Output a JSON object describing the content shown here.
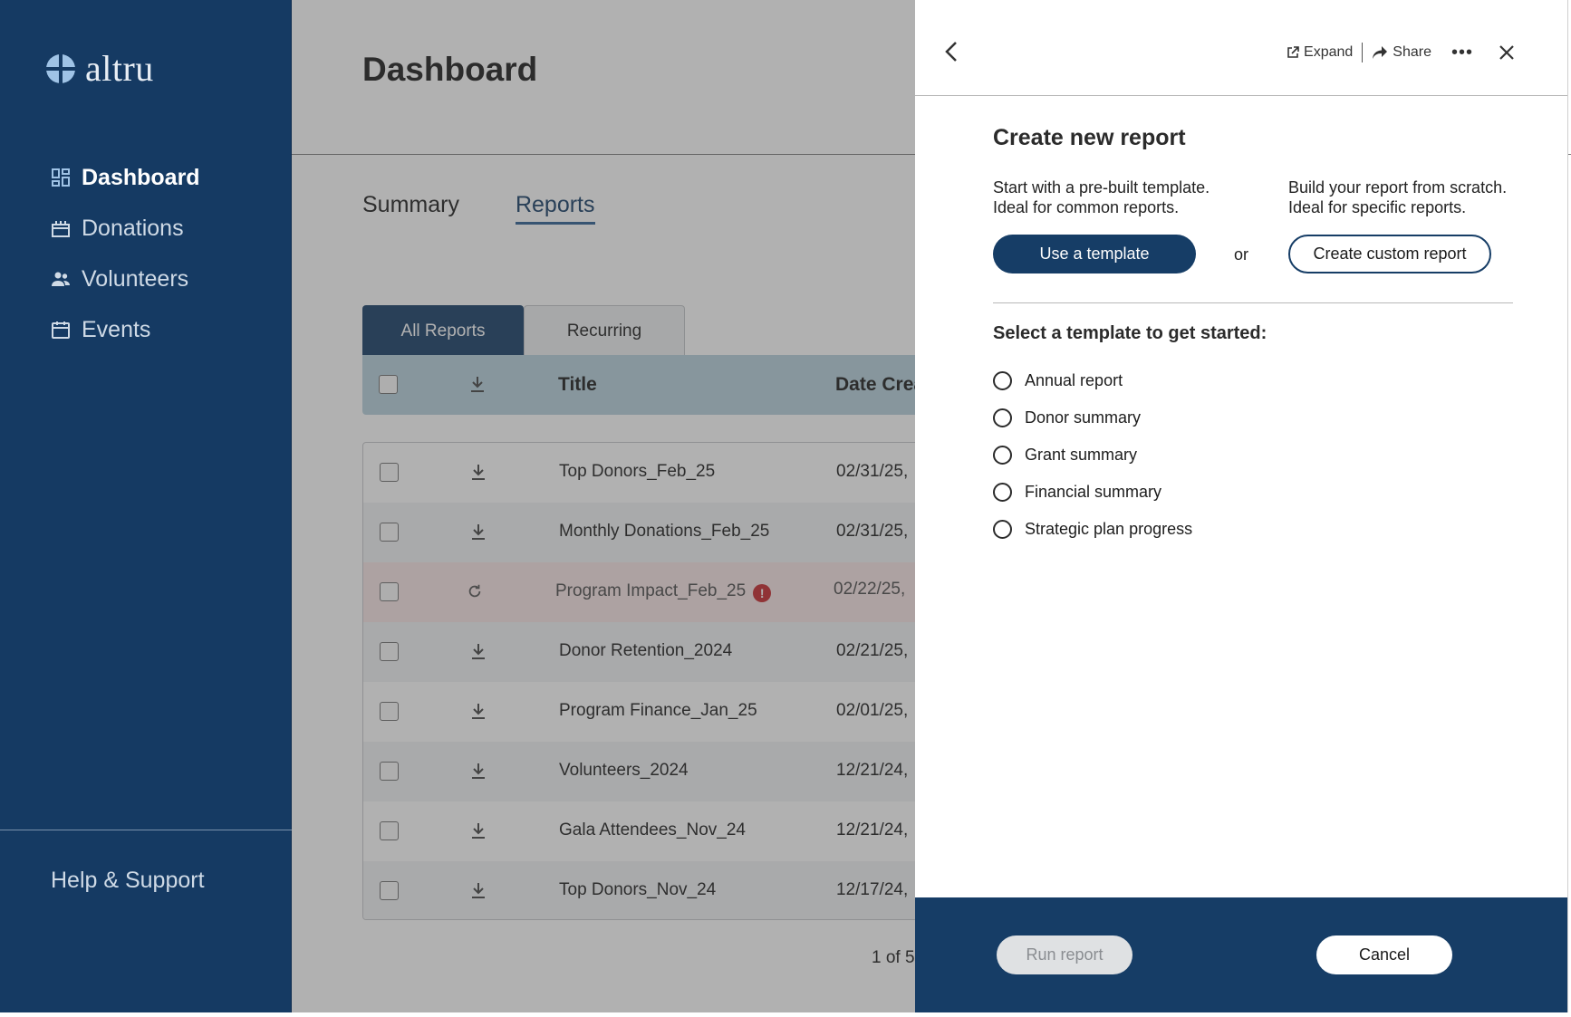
{
  "sidebar": {
    "logo_text": "altru",
    "nav": [
      {
        "label": "Dashboard",
        "icon": "dashboard-icon",
        "active": true
      },
      {
        "label": "Donations",
        "icon": "gift-icon"
      },
      {
        "label": "Volunteers",
        "icon": "people-icon"
      },
      {
        "label": "Events",
        "icon": "calendar-icon"
      }
    ],
    "help_label": "Help & Support"
  },
  "main": {
    "page_title": "Dashboard",
    "tabs": [
      {
        "label": "Summary"
      },
      {
        "label": "Reports",
        "active": true
      }
    ],
    "subtabs": [
      {
        "label": "All Reports",
        "active": true
      },
      {
        "label": "Recurring"
      }
    ],
    "table": {
      "columns": [
        "Title",
        "Date Crea"
      ],
      "rows": [
        {
          "title": "Top Donors_Feb_25",
          "date": "02/31/25,",
          "icon": "download-icon"
        },
        {
          "title": "Monthly Donations_Feb_25",
          "date": "02/31/25,",
          "icon": "download-icon"
        },
        {
          "title": "Program Impact_Feb_25",
          "date": "02/22/25,",
          "icon": "refresh-icon",
          "error": true,
          "error_mark": "!"
        },
        {
          "title": "Donor Retention_2024",
          "date": "02/21/25,",
          "icon": "download-icon"
        },
        {
          "title": "Program Finance_Jan_25",
          "date": "02/01/25,",
          "icon": "download-icon"
        },
        {
          "title": "Volunteers_2024",
          "date": "12/21/24,",
          "icon": "download-icon"
        },
        {
          "title": "Gala Attendees_Nov_24",
          "date": "12/21/24,",
          "icon": "download-icon"
        },
        {
          "title": "Top Donors_Nov_24",
          "date": "12/17/24,",
          "icon": "download-icon"
        }
      ]
    },
    "pager": "1 of 5"
  },
  "panel": {
    "actions": {
      "expand": "Expand",
      "share": "Share"
    },
    "title": "Create new report",
    "template_desc_1": "Start with a pre-built template.",
    "template_desc_2": "Ideal for common reports.",
    "custom_desc_1": "Build your report from scratch.",
    "custom_desc_2": "Ideal for specific reports.",
    "use_template_label": "Use a template",
    "or_label": "or",
    "custom_label": "Create custom report",
    "select_label": "Select a template to get started:",
    "templates": [
      "Annual report",
      "Donor summary",
      "Grant summary",
      "Financial summary",
      "Strategic plan progress"
    ],
    "run_label": "Run report",
    "cancel_label": "Cancel"
  },
  "colors": {
    "brand": "#163d66",
    "sidebar": "#153a63",
    "error": "#c6272b",
    "header_row": "#b7d0dc"
  }
}
